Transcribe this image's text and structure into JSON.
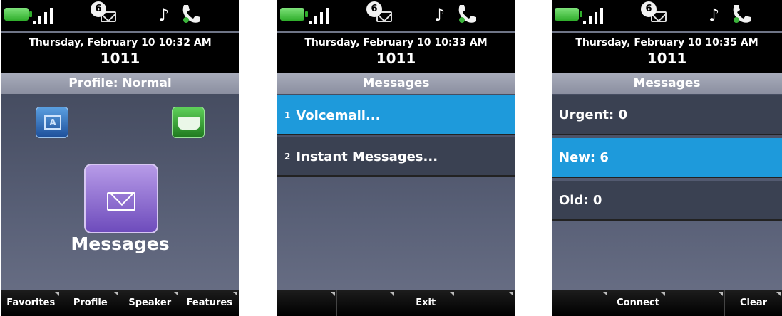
{
  "screens": [
    {
      "datetime": "Thursday, February 10 10:32 AM",
      "extension": "1011",
      "message_count": "6",
      "title": "Profile: Normal",
      "center_label": "Messages",
      "softkeys": [
        "Favorites",
        "Profile",
        "Speaker",
        "Features"
      ]
    },
    {
      "datetime": "Thursday, February 10 10:33 AM",
      "extension": "1011",
      "message_count": "6",
      "title": "Messages",
      "items": [
        {
          "num": "1",
          "label": "Voicemail..."
        },
        {
          "num": "2",
          "label": "Instant Messages..."
        }
      ],
      "softkeys": [
        "",
        "",
        "Exit",
        ""
      ]
    },
    {
      "datetime": "Thursday, February 10 10:35 AM",
      "extension": "1011",
      "message_count": "6",
      "title": "Messages",
      "items": [
        {
          "label": "Urgent: 0"
        },
        {
          "label": "New: 6"
        },
        {
          "label": "Old: 0"
        }
      ],
      "softkeys": [
        "",
        "Connect",
        "",
        "Clear"
      ]
    }
  ],
  "icons": {
    "battery": "battery-icon",
    "signal": "signal-icon",
    "envelope": "envelope-icon",
    "ringer": "music-note-icon",
    "handset": "handset-icon"
  },
  "colors": {
    "selected_row": "#1e9adb",
    "battery": "#2fae2b",
    "messages_tile": "#8a66d0"
  }
}
